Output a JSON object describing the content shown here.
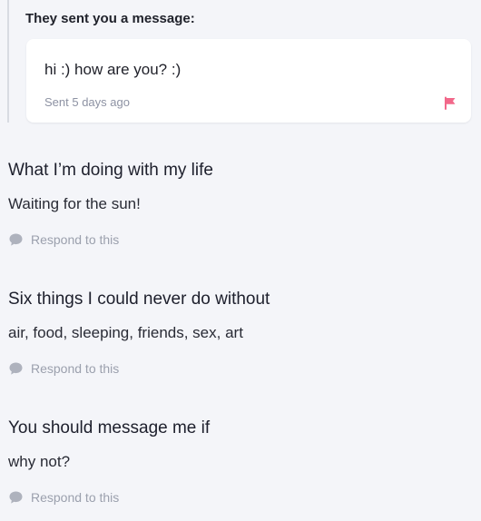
{
  "message": {
    "heading": "They sent you a message:",
    "text": "hi :) how are you? :)",
    "meta": "Sent 5 days ago"
  },
  "sections": [
    {
      "title": "What I’m doing with my life",
      "answer": "Waiting for the sun!",
      "respond_label": "Respond to this"
    },
    {
      "title": "Six things I could never do without",
      "answer": "air, food, sleeping, friends, sex, art",
      "respond_label": "Respond to this"
    },
    {
      "title": "You should message me if",
      "answer": "why not?",
      "respond_label": "Respond to this"
    }
  ],
  "icons": {
    "flag": "flag-icon",
    "speech_bubble": "speech-bubble-icon"
  },
  "colors": {
    "background": "#f4f5f9",
    "card": "#ffffff",
    "flag": "#f2688a",
    "muted": "#9ba0ad"
  }
}
